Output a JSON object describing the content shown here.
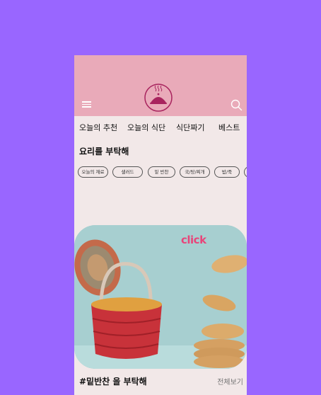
{
  "header": {
    "menu_icon": "hamburger-menu-icon",
    "logo_icon": "steaming-dish-logo",
    "search_icon": "search-icon",
    "colors": {
      "header_bg": "#e9aab9",
      "logo": "#a8245e"
    }
  },
  "nav": {
    "tabs": [
      "오늘의 추천",
      "오늘의 식단",
      "식단짜기",
      "베스트"
    ]
  },
  "request": {
    "title": "요리를 부탁해",
    "chips": [
      "오늘의 재료",
      "샐러드",
      "밑 반찬",
      "국/탕/찌개",
      "밥/죽"
    ]
  },
  "banner": {
    "label": "click",
    "label_color": "#e8457a"
  },
  "side_dish": {
    "title": "#밑반찬 을 부탁해",
    "view_all": "전체보기"
  },
  "colors": {
    "background": "#9966ff",
    "screen": "#f2e8e8"
  }
}
